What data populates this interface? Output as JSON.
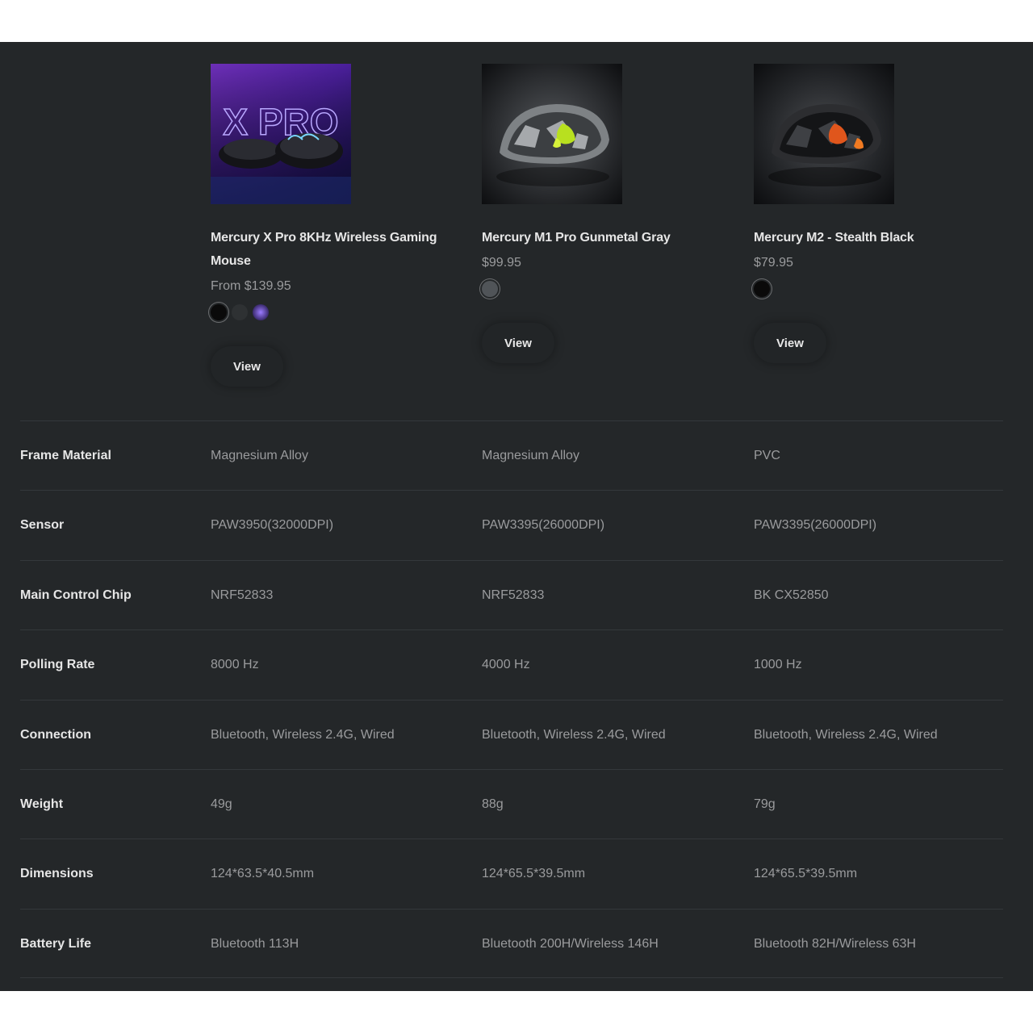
{
  "products": [
    {
      "name": "Mercury X Pro 8KHz Wireless Gaming Mouse",
      "price": "From $139.95",
      "image_text": "X PRO",
      "swatches": [
        "#0a0a0a",
        "#2e3133",
        "#3a2a6e"
      ],
      "view_label": "View"
    },
    {
      "name": "Mercury M1 Pro Gunmetal Gray",
      "price": "$99.95",
      "swatches": [
        "#505458"
      ],
      "view_label": "View"
    },
    {
      "name": "Mercury M2 - Stealth Black",
      "price": "$79.95",
      "swatches": [
        "#0a0a0a"
      ],
      "view_label": "View"
    }
  ],
  "specs": [
    {
      "label": "Frame Material",
      "values": [
        "Magnesium Alloy",
        "Magnesium Alloy",
        "PVC"
      ]
    },
    {
      "label": "Sensor",
      "values": [
        "PAW3950(32000DPI)",
        "PAW3395(26000DPI)",
        "PAW3395(26000DPI)"
      ]
    },
    {
      "label": "Main Control Chip",
      "values": [
        "NRF52833",
        "NRF52833",
        "BK CX52850"
      ]
    },
    {
      "label": "Polling Rate",
      "values": [
        "8000 Hz",
        "4000 Hz",
        "1000 Hz"
      ]
    },
    {
      "label": "Connection",
      "values": [
        "Bluetooth, Wireless 2.4G, Wired",
        "Bluetooth, Wireless 2.4G, Wired",
        "Bluetooth, Wireless 2.4G, Wired"
      ]
    },
    {
      "label": "Weight",
      "values": [
        "49g",
        "88g",
        "79g"
      ]
    },
    {
      "label": "Dimensions",
      "values": [
        "124*63.5*40.5mm",
        "124*65.5*39.5mm",
        "124*65.5*39.5mm"
      ]
    },
    {
      "label": "Battery Life",
      "values": [
        "Bluetooth 113H",
        "Bluetooth 200H/Wireless 146H",
        "Bluetooth 82H/Wireless 63H"
      ]
    }
  ]
}
